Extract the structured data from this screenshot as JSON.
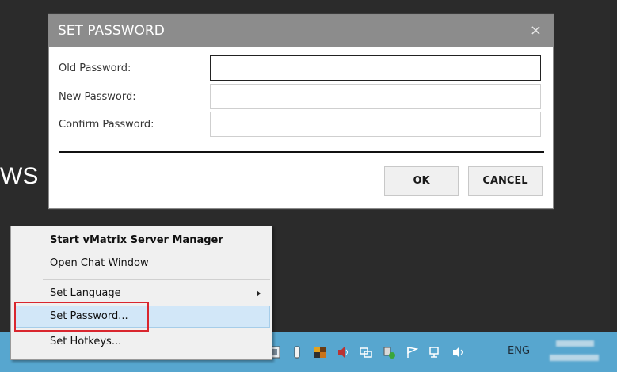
{
  "background": {
    "partial_text": "WS"
  },
  "dialog": {
    "title": "SET PASSWORD",
    "close_glyph": "×",
    "fields": [
      {
        "label": "Old Password:",
        "value": ""
      },
      {
        "label": "New Password:",
        "value": ""
      },
      {
        "label": "Confirm Password:",
        "value": ""
      }
    ],
    "ok_label": "OK",
    "cancel_label": "CANCEL"
  },
  "context_menu": {
    "items": [
      {
        "label": "Start vMatrix Server Manager",
        "bold": true
      },
      {
        "label": "Open Chat Window"
      },
      {
        "label": "Set Language",
        "submenu": true
      },
      {
        "label": "Set Password...",
        "highlighted": true
      },
      {
        "label": "Set Hotkeys..."
      }
    ]
  },
  "taskbar": {
    "tray_icons": [
      "app-tray-icon",
      "usb-eject-icon",
      "color-app-icon",
      "speaker-icon",
      "display-icon",
      "network-security-icon",
      "flag-action-center-icon",
      "network-icon",
      "volume-icon"
    ],
    "language": "ENG"
  },
  "colors": {
    "taskbar": "#57a6cf",
    "dialog_title_bar": "#8c8c8c",
    "menu_highlight": "#d2e7f8",
    "annotation_box": "#d9262e"
  }
}
